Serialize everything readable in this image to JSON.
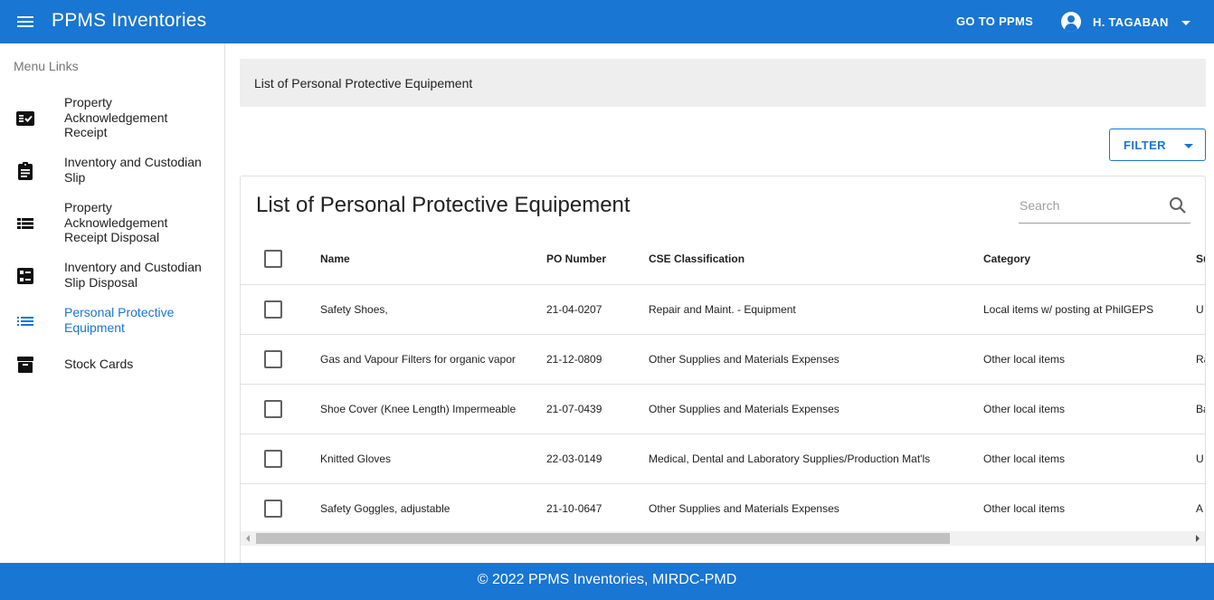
{
  "appbar": {
    "title": "PPMS Inventories",
    "goto_label": "GO TO PPMS",
    "user_name": "H. TAGABAN"
  },
  "sidebar": {
    "subheader": "Menu Links",
    "items": [
      {
        "label": "Property Acknowledgement Receipt",
        "icon": "fact-check-icon",
        "active": false
      },
      {
        "label": "Inventory and Custodian Slip",
        "icon": "assignment-icon",
        "active": false
      },
      {
        "label": "Property Acknowledgement Receipt Disposal",
        "icon": "view-list-icon",
        "active": false
      },
      {
        "label": "Inventory and Custodian Slip Disposal",
        "icon": "ballot-icon",
        "active": false
      },
      {
        "label": "Personal Protective Equipment",
        "icon": "list-icon",
        "active": true
      },
      {
        "label": "Stock Cards",
        "icon": "archive-icon",
        "active": false
      }
    ]
  },
  "main": {
    "breadcrumb": "List of Personal Protective Equipement",
    "filter_label": "FILTER",
    "card_title": "List of Personal Protective Equipement",
    "search_placeholder": "Search",
    "columns": [
      "Name",
      "PO Number",
      "CSE Classification",
      "Category",
      "Su"
    ],
    "rows": [
      [
        "Safety Shoes,",
        "21-04-0207",
        "Repair and Maint. - Equipment",
        "Local items w/ posting at PhilGEPS",
        "U"
      ],
      [
        "Gas and Vapour Filters for organic vapor",
        "21-12-0809",
        "Other Supplies and Materials Expenses",
        "Other local items",
        "Ra"
      ],
      [
        "Shoe Cover (Knee Length) Impermeable",
        "21-07-0439",
        "Other Supplies and Materials Expenses",
        "Other local items",
        "Ba"
      ],
      [
        "Knitted Gloves",
        "22-03-0149",
        "Medical, Dental and Laboratory Supplies/Production Mat'ls",
        "Other local items",
        "U"
      ],
      [
        "Safety Goggles, adjustable",
        "21-10-0647",
        "Other Supplies and Materials Expenses",
        "Other local items",
        "A"
      ]
    ]
  },
  "footer": {
    "text": "© 2022 PPMS Inventories, MIRDC-PMD"
  },
  "colors": {
    "primary": "#1976d2",
    "breadcrumb_bg": "#eeeeee"
  }
}
